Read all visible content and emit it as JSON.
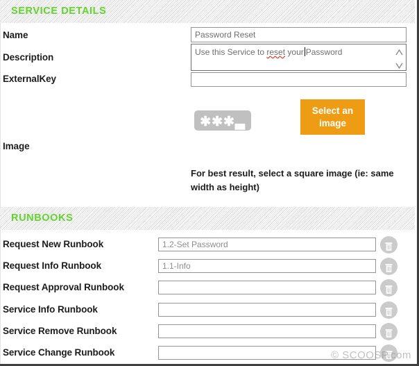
{
  "sections": {
    "service_details": {
      "title": "SERVICE DETAILS",
      "fields": {
        "name": {
          "label": "Name",
          "value": "Password Reset",
          "placeholder": "Password Reset"
        },
        "description": {
          "label": "Description",
          "value_before": "Use this Service to ",
          "value_misspelled": "reset",
          "value_mid": " your",
          "value_after": "Password"
        },
        "external_key": {
          "label": "ExternalKey",
          "value": "",
          "placeholder": ""
        },
        "image": {
          "label": "Image",
          "thumbnail_icon": "password-asterisks-icon",
          "thumbnail_text": "✱✱✱",
          "thumbnail_underscore": "▃",
          "select_button": "Select an image",
          "hint": "For best result, select a square image (ie: same width as height)"
        }
      }
    },
    "runbooks": {
      "title": "RUNBOOKS",
      "rows": [
        {
          "label": "Request New Runbook",
          "value": "1.2-Set Password",
          "delete_icon": "trash-icon"
        },
        {
          "label": "Request Info Runbook",
          "value": "1.1-Info",
          "delete_icon": "trash-icon"
        },
        {
          "label": "Request Approval Runbook",
          "value": "",
          "delete_icon": "trash-icon"
        },
        {
          "label": "Service Info Runbook",
          "value": "",
          "delete_icon": "trash-icon"
        },
        {
          "label": "Service Remove Runbook",
          "value": "",
          "delete_icon": "trash-icon"
        },
        {
          "label": "Service Change Runbook",
          "value": "",
          "delete_icon": "trash-icon"
        }
      ]
    }
  },
  "watermark": "© SCOOSP.com",
  "colors": {
    "header_green": "#62d42d",
    "button_orange": "#ef9c15",
    "thumb_gray": "#c0c0c0",
    "trash_gray": "#cbcbcb"
  }
}
